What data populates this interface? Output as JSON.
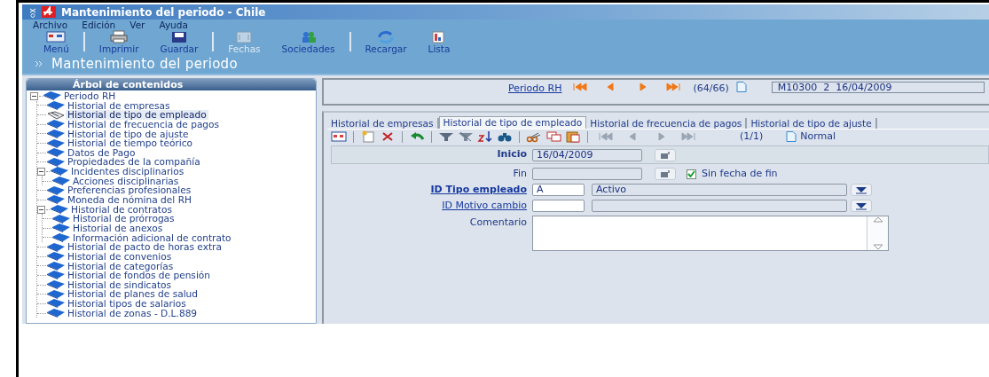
{
  "window": {
    "title": "Mantenimiento del periodo - Chile"
  },
  "menu": [
    {
      "label": "Archivo"
    },
    {
      "label": "Edición"
    },
    {
      "label": "Ver"
    },
    {
      "label": "Ayuda"
    }
  ],
  "toolbar": [
    {
      "kind": "menu",
      "label": "Menú",
      "disabled": false
    },
    {
      "kind": "separator"
    },
    {
      "kind": "print",
      "label": "Imprimir",
      "disabled": false
    },
    {
      "kind": "save",
      "label": "Guardar",
      "disabled": false
    },
    {
      "kind": "separator"
    },
    {
      "kind": "calendar",
      "label": "Fechas",
      "disabled": true
    },
    {
      "kind": "people",
      "label": "Sociedades",
      "disabled": false
    },
    {
      "kind": "separator"
    },
    {
      "kind": "reload",
      "label": "Recargar",
      "disabled": false
    },
    {
      "kind": "list",
      "label": "Lista",
      "disabled": false
    }
  ],
  "page_title": "Mantenimiento del periodo",
  "sidebar": {
    "title": "Árbol de contenidos",
    "tree": [
      {
        "label": "Periodo RH",
        "selected": false,
        "expanded": true,
        "children": [
          {
            "label": "Historial de empresas",
            "selected": false
          },
          {
            "label": "Historial de tipo de empleado",
            "selected": true
          },
          {
            "label": "Historial de frecuencia de pagos",
            "selected": false
          },
          {
            "label": "Historial de tipo de ajuste",
            "selected": false
          },
          {
            "label": "Historial de tiempo teórico",
            "selected": false
          },
          {
            "label": "Datos de Pago",
            "selected": false
          },
          {
            "label": "Propiedades de la compañía",
            "selected": false
          },
          {
            "label": "Incidentes disciplinarios",
            "selected": false,
            "expanded": true,
            "children": [
              {
                "label": "Acciones disciplinarias",
                "selected": false
              }
            ]
          },
          {
            "label": "Preferencias profesionales",
            "selected": false
          },
          {
            "label": "Moneda de nómina del RH",
            "selected": false
          },
          {
            "label": "Historial de contratos",
            "selected": false,
            "expanded": true,
            "children": [
              {
                "label": "Historial de prórrogas",
                "selected": false
              },
              {
                "label": "Historial de anexos",
                "selected": false
              },
              {
                "label": "Información adicional de contrato",
                "selected": false
              }
            ]
          },
          {
            "label": "Historial de pacto de horas extra",
            "selected": false
          },
          {
            "label": "Historial de convenios",
            "selected": false
          },
          {
            "label": "Historial de categorías",
            "selected": false
          },
          {
            "label": "Historial de fondos de pensión",
            "selected": false
          },
          {
            "label": "Historial de sindicatos",
            "selected": false
          },
          {
            "label": "Historial de planes de salud",
            "selected": false
          },
          {
            "label": "Historial tipos de salarios",
            "selected": false
          },
          {
            "label": "Historial de zonas - D.L.889",
            "selected": false
          }
        ]
      }
    ]
  },
  "record_nav": {
    "link": "Periodo RH",
    "counter": "(64/66)",
    "value": "M10300  2  16/04/2009"
  },
  "tabs": [
    {
      "label": "Historial de empresas",
      "selected": false
    },
    {
      "label": "Historial de tipo de empleado",
      "selected": true
    },
    {
      "label": "Historial de frecuencia de pagos",
      "selected": false
    },
    {
      "label": "Historial de tipo de ajuste",
      "selected": false
    }
  ],
  "subtoolbar": [
    {
      "kind": "grid"
    },
    {
      "kind": "separator"
    },
    {
      "kind": "new"
    },
    {
      "kind": "delete"
    },
    {
      "kind": "separator"
    },
    {
      "kind": "undo"
    },
    {
      "kind": "separator"
    },
    {
      "kind": "filter"
    },
    {
      "kind": "clear-filter"
    },
    {
      "kind": "sort"
    },
    {
      "kind": "find"
    },
    {
      "kind": "separator"
    },
    {
      "kind": "cut"
    },
    {
      "kind": "copy"
    },
    {
      "kind": "paste"
    },
    {
      "kind": "separator"
    },
    {
      "kind": "first",
      "disabled": true
    },
    {
      "kind": "prev",
      "disabled": true
    },
    {
      "kind": "next",
      "disabled": true
    },
    {
      "kind": "last",
      "disabled": true
    }
  ],
  "subtoolbar_counter": "(1/1)",
  "subtoolbar_mode": "Normal",
  "form": {
    "inicio": {
      "label": "Inicio",
      "value": "16/04/2009"
    },
    "fin": {
      "label": "Fin",
      "checkbox": {
        "label": "Sin fecha de fin",
        "checked": true
      }
    },
    "tipo": {
      "label": "ID Tipo empleado",
      "code": "A",
      "description": "Activo"
    },
    "motivo": {
      "label": "ID Motivo cambio"
    },
    "comentario": {
      "label": "Comentario"
    }
  }
}
